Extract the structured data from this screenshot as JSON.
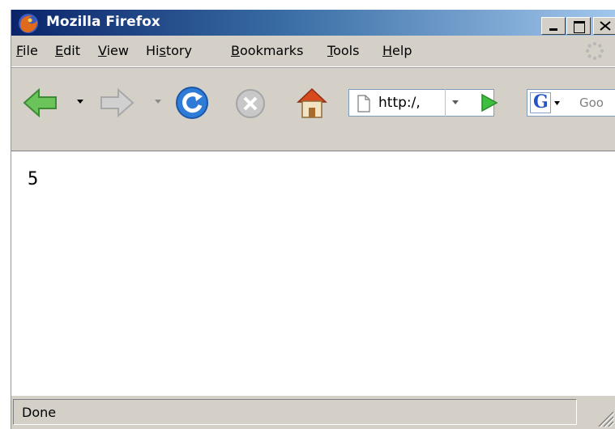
{
  "window": {
    "title": "Mozilla Firefox",
    "titlebar_colors": [
      "#0a246a",
      "#3a6ea5",
      "#a6caf0"
    ]
  },
  "menu": [
    {
      "label": "File",
      "accel": "F"
    },
    {
      "label": "Edit",
      "accel": "E"
    },
    {
      "label": "View",
      "accel": "V"
    },
    {
      "label": "History",
      "accel": "s"
    },
    {
      "label": "Bookmarks",
      "accel": "B"
    },
    {
      "label": "Tools",
      "accel": "T"
    },
    {
      "label": "Help",
      "accel": "H"
    }
  ],
  "toolbar": {
    "back_icon": "back-arrow-icon",
    "forward_icon": "forward-arrow-icon",
    "reload_icon": "reload-icon",
    "stop_icon": "stop-icon",
    "home_icon": "home-icon",
    "url": "http:/,",
    "go_icon": "go-arrow-icon",
    "search_engine_icon": "google-g-icon",
    "search_placeholder": "Goo"
  },
  "content": {
    "text": "5"
  },
  "status": {
    "text": "Done"
  }
}
